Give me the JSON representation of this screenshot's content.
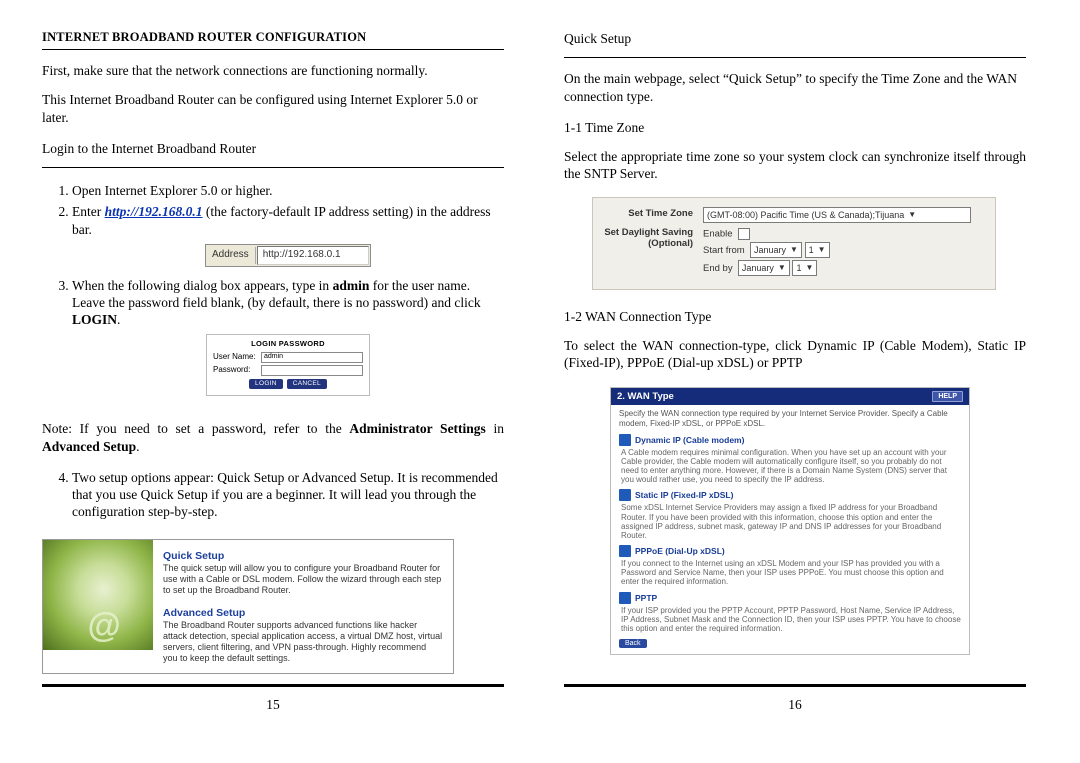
{
  "left": {
    "title": "INTERNET BROADBAND ROUTER CONFIGURATION",
    "intro1": "First, make sure that the network connections are functioning normally.",
    "intro2": "This Internet Broadband Router can be configured using Internet Explorer 5.0 or later.",
    "login_heading": "Login to the Internet Broadband Router",
    "step1": "Open Internet Explorer 5.0 or higher.",
    "step2_a": "Enter ",
    "step2_link": "http://192.168.0.1",
    "step2_b": " (the factory-default IP address setting) in the address bar.",
    "addr_label": "Address",
    "addr_value": "http://192.168.0.1",
    "step3_a": "When the following dialog box appears, type in ",
    "step3_bold": "admin",
    "step3_b": " for the user name.  Leave the password field blank, (by default, there is no password) and click ",
    "step3_login": "LOGIN",
    "step3_c": ".",
    "login_dialog": {
      "title": "LOGIN PASSWORD",
      "user_label": "User Name:",
      "user_value": "admin",
      "pass_label": "Password:",
      "btn_login": "LOGIN",
      "btn_cancel": "CANCEL"
    },
    "note_a": "Note: If you need to set a password, refer to the ",
    "note_bold1": "Administrator Settings",
    "note_b": " in ",
    "note_bold2": "Advanced Setup",
    "note_c": ".",
    "step4": "Two setup options appear: Quick Setup or Advanced Setup. It is recommended that you use Quick Setup if you are a beginner. It will lead you through the configuration step-by-step.",
    "setup": {
      "quick_title": "Quick Setup",
      "quick_text": "The quick setup will allow you to configure your Broadband Router for use with a Cable or DSL modem. Follow the wizard through each step to set up the Broadband Router.",
      "adv_title": "Advanced Setup",
      "adv_text": "The Broadband Router supports advanced functions like hacker attack detection, special application access, a virtual DMZ host, virtual servers, client filtering, and VPN pass-through. Highly recommend you to keep the default settings."
    },
    "page_num": "15"
  },
  "right": {
    "qs_heading": "Quick Setup",
    "qs_text": "On the main webpage, select “Quick Setup” to specify the Time Zone and the WAN connection type.",
    "tz_heading": "1-1 Time Zone",
    "tz_text": "Select the appropriate time zone so your system clock can synchronize itself through the SNTP Server.",
    "tz_fig": {
      "label_tz": "Set Time Zone",
      "tz_value": "(GMT-08:00) Pacific Time (US & Canada);Tijuana",
      "enable": "Enable",
      "label_ds": "Set Daylight Saving (Optional)",
      "start": "Start from",
      "end": "End by",
      "month": "January",
      "day": "1"
    },
    "wan_heading": "1-2 WAN Connection Type",
    "wan_text": "To select the WAN connection-type, click Dynamic IP (Cable Modem), Static IP (Fixed-IP),  PPPoE (Dial-up xDSL) or PPTP",
    "wan_fig": {
      "title": "2. WAN Type",
      "help": "HELP",
      "lead": "Specify the WAN connection type required by your Internet Service Provider. Specify a Cable modem, Fixed-IP xDSL, or PPPoE xDSL.",
      "opt1": "Dynamic IP (Cable modem)",
      "opt1_desc": "A Cable modem requires minimal configuration. When you have set up an account with your Cable provider, the Cable modem will automatically configure itself, so you probably do not need to enter anything more. However, if there is a Domain Name System (DNS) server that you would rather use, you need to specify the IP address.",
      "opt2": "Static IP (Fixed-IP xDSL)",
      "opt2_desc": "Some xDSL Internet Service Providers may assign a fixed IP address for your Broadband Router. If you have been provided with this information, choose this option and enter the assigned IP address, subnet mask, gateway IP and DNS IP addresses for your Broadband Router.",
      "opt3": "PPPoE (Dial-Up xDSL)",
      "opt3_desc": "If you connect to the Internet using an xDSL Modem and your ISP has provided you with a Password and Service Name, then your ISP uses PPPoE. You must choose this option and enter the required information.",
      "opt4": "PPTP",
      "opt4_desc": "If your ISP provided you the PPTP Account, PPTP Password, Host Name, Service IP Address, IP Address, Subnet Mask and the Connection ID, then your ISP uses PPTP. You have to choose this option and enter the required information.",
      "back": "Back"
    },
    "page_num": "16"
  }
}
